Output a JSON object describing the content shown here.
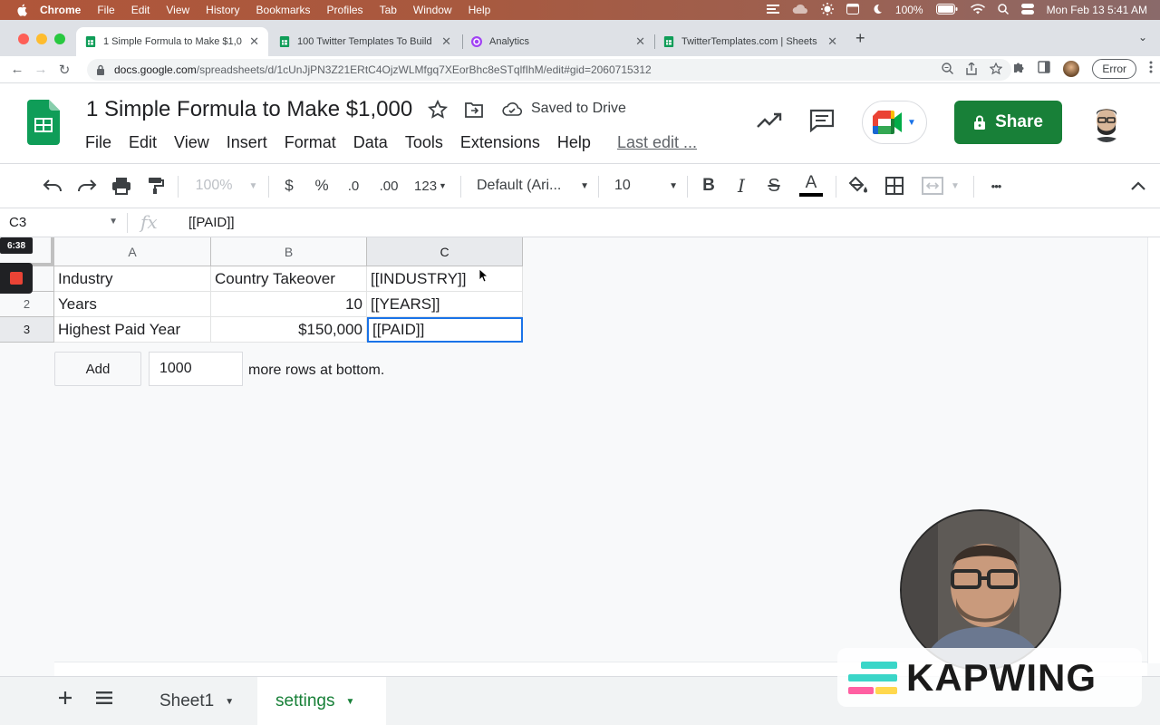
{
  "menubar": {
    "app": "Chrome",
    "items": [
      "File",
      "Edit",
      "View",
      "History",
      "Bookmarks",
      "Profiles",
      "Tab",
      "Window",
      "Help"
    ],
    "battery": "100%",
    "datetime": "Mon Feb 13  5:41 AM"
  },
  "tabs": [
    {
      "label": "1 Simple Formula to Make $1,0",
      "active": true
    },
    {
      "label": "100 Twitter Templates To Build",
      "active": false
    },
    {
      "label": "Analytics",
      "active": false
    },
    {
      "label": "TwitterTemplates.com | Sheets",
      "active": false
    }
  ],
  "address": {
    "host": "docs.google.com",
    "path": "/spreadsheets/d/1cUnJjPN3Z21ERtC4OjzWLMfgq7XEorBhc8eSTqlfIhM/edit#gid=2060715312",
    "error_label": "Error"
  },
  "sheets": {
    "title": "1 Simple Formula to Make $1,000",
    "saved_label": "Saved to Drive",
    "menus": [
      "File",
      "Edit",
      "View",
      "Insert",
      "Format",
      "Data",
      "Tools",
      "Extensions",
      "Help"
    ],
    "last_edit": "Last edit ...",
    "share_label": "Share"
  },
  "toolbar": {
    "zoom": "100%",
    "currency": "$",
    "percent": "%",
    "dec_decrease": ".0",
    "dec_increase": ".00",
    "format_more": "123",
    "font": "Default (Ari...",
    "font_size": "10",
    "bold": "B",
    "italic": "I",
    "strike": "S",
    "text_color": "A",
    "more": "•••"
  },
  "formula_bar": {
    "cell_ref": "C3",
    "fx": "fx",
    "content": "[[PAID]]"
  },
  "grid": {
    "columns": [
      "A",
      "B",
      "C"
    ],
    "row_labels": [
      "",
      "2",
      "3"
    ],
    "rows": [
      [
        "Industry",
        "Country Takeover",
        "[[INDUSTRY]]"
      ],
      [
        "Years",
        "10",
        "[[YEARS]]"
      ],
      [
        "Highest Paid Year",
        "$150,000",
        "[[PAID]]"
      ]
    ],
    "add_label": "Add",
    "add_count": "1000",
    "add_suffix": "more rows at bottom."
  },
  "recording": {
    "timer": "6:38"
  },
  "sheet_tabs": [
    {
      "label": "Sheet1",
      "active": false
    },
    {
      "label": "settings",
      "active": true
    }
  ],
  "watermark": {
    "text": "KAPWING"
  },
  "colors": {
    "sheets_green": "#188038",
    "selection_blue": "#1a73e8"
  }
}
